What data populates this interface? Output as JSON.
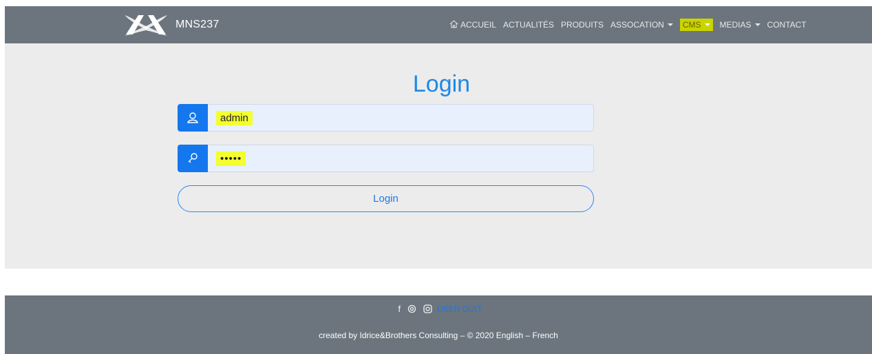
{
  "header": {
    "brand": "MNS237",
    "nav": [
      {
        "label": "ACCUEIL",
        "icon": "home-icon",
        "dropdown": false
      },
      {
        "label": "ACTUALITÉS",
        "dropdown": false
      },
      {
        "label": "PRODUITS",
        "dropdown": false
      },
      {
        "label": "ASSOCATION",
        "dropdown": true
      },
      {
        "label": "CMS",
        "dropdown": true,
        "highlighted": true
      },
      {
        "label": "MEDIAS",
        "dropdown": true
      },
      {
        "label": "CONTACT",
        "dropdown": false
      }
    ]
  },
  "login": {
    "title": "Login",
    "username_value": "admin",
    "password_value": "•••••",
    "button_label": "Login"
  },
  "footer": {
    "user_guide": "USER GUIT",
    "credits": "created by Idrice&Brothers Consulting – © 2020 English – French"
  },
  "colors": {
    "navbar": "#6c757d",
    "accent": "#1477ee",
    "highlight": "#f3ff2f",
    "main_bg": "#ececec"
  }
}
